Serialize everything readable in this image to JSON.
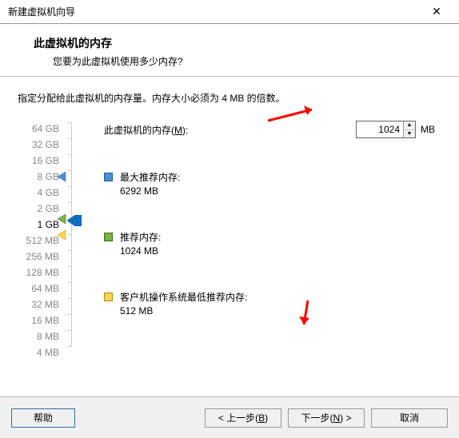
{
  "titlebar": {
    "title": "新建虚拟机向导"
  },
  "header": {
    "heading": "此虚拟机的内存",
    "sub": "您要为此虚拟机使用多少内存?"
  },
  "instruction": "指定分配给此虚拟机的内存量。内存大小必须为 4 MB 的倍数。",
  "memory": {
    "label_prefix": "此虚拟机的内存(",
    "label_hotkey": "M",
    "label_suffix": "):",
    "value": "1024",
    "unit": "MB"
  },
  "scale": [
    "64 GB",
    "32 GB",
    "16 GB",
    "8 GB",
    "4 GB",
    "2 GB",
    "1 GB",
    "512 MB",
    "256 MB",
    "128 MB",
    "64 MB",
    "32 MB",
    "16 MB",
    "8 MB",
    "4 MB"
  ],
  "info": {
    "max": {
      "label": "最大推荐内存:",
      "value": "6292 MB"
    },
    "rec": {
      "label": "推荐内存:",
      "value": "1024 MB"
    },
    "min": {
      "label": "客户机操作系统最低推荐内存:",
      "value": "512 MB"
    }
  },
  "buttons": {
    "help": "帮助",
    "back_prefix": "< 上一步(",
    "back_hotkey": "B",
    "back_suffix": ")",
    "next_prefix": "下一步(",
    "next_hotkey": "N",
    "next_suffix": ") >",
    "cancel": "取消"
  }
}
